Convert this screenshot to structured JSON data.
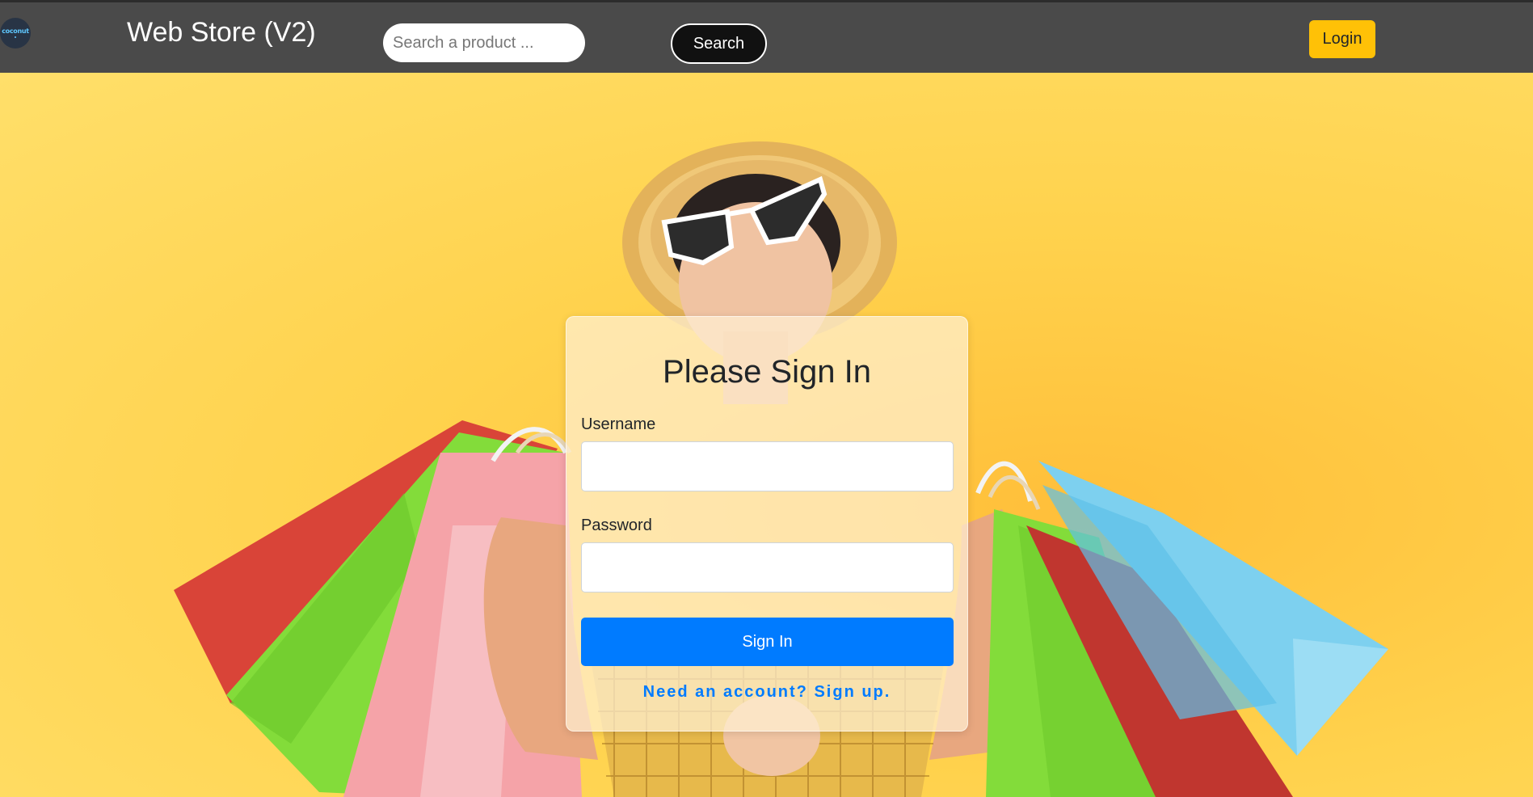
{
  "header": {
    "logo_text": "coconut",
    "brand": "Web Store (V2)",
    "search_placeholder": "Search a product ...",
    "search_label": "Search",
    "login_label": "Login"
  },
  "hero": {
    "image": "shopping-woman-with-bags"
  },
  "signin": {
    "title": "Please Sign In",
    "username_label": "Username",
    "username_value": "",
    "password_label": "Password",
    "password_value": "",
    "submit_label": "Sign In",
    "signup_link": "Need an account? Sign up."
  },
  "colors": {
    "navbar": "#4a4a4a",
    "login_button": "#ffc107",
    "primary": "#007bff",
    "background": "#ffd24d"
  }
}
